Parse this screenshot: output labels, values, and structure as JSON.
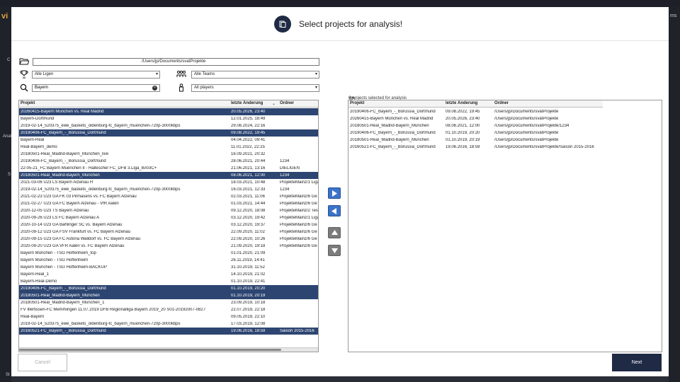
{
  "background": {
    "logo": "vi",
    "frag_right": "ms",
    "frag_left1": "C",
    "frag_left2": "Anal",
    "frag_left3": "S",
    "frag_left4": "St"
  },
  "dialog": {
    "title": "Select projects for analysis!"
  },
  "filters": {
    "path": "/Users/jp/Documents/svatProjekte",
    "league": "Alle Ligen",
    "team": "Alle Teams",
    "search": "Bayern",
    "player": "All players"
  },
  "left_table": {
    "columns": [
      "Projekt",
      "letzte Änderung",
      "Ordner"
    ],
    "sort_indicator": "⌄",
    "rows": [
      {
        "p": "20260415-Bayern München vs. Real Madrid",
        "d": "20.05.2026, 23:40",
        "o": "",
        "sel": true
      },
      {
        "p": "Bayern-Dortmund",
        "d": "12.01.2025, 18:49",
        "o": "",
        "sel": false
      },
      {
        "p": "2019-02-14_520375_ewe_baskets_oldenburg-fc_bayern_muenchen-720p-3000kbps",
        "d": "29.08.2024, 22:16",
        "o": "",
        "sel": false
      },
      {
        "p": "20190406-FC_Bayern_-_Borussia_Dortmund",
        "d": "09.08.2022, 19:45",
        "o": "",
        "sel": true
      },
      {
        "p": "Bayern-Real",
        "d": "04.04.2022, 09:41",
        "o": "",
        "sel": false
      },
      {
        "p": "Real-Bayern_demo",
        "d": "11.01.2022, 22:25",
        "o": "",
        "sel": false
      },
      {
        "p": "20180501-Real_Madrid-Bayern_München_live",
        "d": "16.09.2021, 20:32",
        "o": "",
        "sel": false
      },
      {
        "p": "20190406-FC_Bayern_-_Borussia_Dortmund",
        "d": "28.06.2021, 20:44",
        "o": "1234",
        "sel": false
      },
      {
        "p": "22-05-21_FC Bayern Muenchen II - Hallescher FC_DFB 3.Liga_BASIC+",
        "d": "21.06.2021, 13:16",
        "o": "DIELIGEN",
        "sel": false
      },
      {
        "p": "20180501-Real_Madrid-Bayern_München",
        "d": "08.06.2021, 12:00",
        "o": "1234",
        "sel": true
      },
      {
        "p": "2021-03-06 U23 LS Bayern Alzenau H",
        "d": "18.03.2021, 10:48",
        "o": "ProjekteMainz/1 Liga",
        "sel": false
      },
      {
        "p": "2019-02-14_520375_ewe_baskets_oldenburg-fc_bayern_muenchen-720p-3000kbps",
        "d": "16.03.2021, 12:33",
        "o": "1234",
        "sel": false
      },
      {
        "p": "2021-02-23 U23 GA FK 03 Pirmasens vs. FC Bayern Alzenau",
        "d": "02.03.2021, 11:06",
        "o": "ProjekteMainz/6 Ge",
        "sel": false
      },
      {
        "p": "2021-02-27 U23 GA FC Bayern Alzenau - VfR Aalen",
        "d": "01.03.2021, 14:44",
        "o": "ProjekteMainz/6 Ge",
        "sel": false
      },
      {
        "p": "2020-12-05 U23 TS Bayern Alzenau",
        "d": "09.12.2020, 18:08",
        "o": "ProjekteMainz/2 Tes",
        "sel": false
      },
      {
        "p": "2020-09-26 U23 LS FC Bayern Alzenau A",
        "d": "03.12.2020, 19:42",
        "o": "ProjekteMainz/1 Liga",
        "sel": false
      },
      {
        "p": "2020-10-14 U23 GA Bahlinger SC vs. Bayern Alzenau",
        "d": "03.12.2020, 19:37",
        "o": "ProjekteMainz/6 Ge",
        "sel": false
      },
      {
        "p": "2020-09-12 U23 GA FSV Frankfurt vs. FC Bayern Alzenau",
        "d": "22.09.2020, 11:02",
        "o": "ProjekteMainz/6 Ge",
        "sel": false
      },
      {
        "p": "2020-09-15 U23 GA FC Astoria Walldorf vs. FC Bayern Alzenau",
        "d": "22.09.2020, 10:26",
        "o": "ProjekteMainz/6 Ge",
        "sel": false
      },
      {
        "p": "2020-09-20 U23 GA VFR Aalen vs. FC Bayern Alzenau",
        "d": "21.09.2020, 19:18",
        "o": "ProjekteMainz/6 Ge",
        "sel": false
      },
      {
        "p": "Bayern München - TSG Hoffenheim_top",
        "d": "01.01.2020, 21:09",
        "o": "",
        "sel": false
      },
      {
        "p": "Bayern München - TSG Hoffenheim",
        "d": "26.11.2019, 14:41",
        "o": "",
        "sel": false
      },
      {
        "p": "Bayern München - TSG Hoffenheim-BACKUP",
        "d": "31.10.2019, 11:52",
        "o": "",
        "sel": false
      },
      {
        "p": "Bayern-Real_1",
        "d": "14.10.2019, 21:02",
        "o": "",
        "sel": false
      },
      {
        "p": "Bayern-Real-Demo",
        "d": "01.10.2019, 22:41",
        "o": "",
        "sel": false
      },
      {
        "p": "20190406-FC_Bayern_-_Borussia_Dortmund",
        "d": "01.10.2019, 20:20",
        "o": "",
        "sel": true
      },
      {
        "p": "20180501-Real_Madrid-Bayern_München",
        "d": "01.10.2019, 20:19",
        "o": "",
        "sel": true
      },
      {
        "p": "20180501-Real_Madrid-Bayern_München_1",
        "d": "23.09.2019, 10:18",
        "o": "",
        "sel": false
      },
      {
        "p": "FV Illertissen-FC Memmingen 11.07.2019 DFB Regionalliga Bayern 2019_20 S01-20192007-0827",
        "d": "22.07.2019, 22:18",
        "o": "",
        "sel": false
      },
      {
        "p": "Real-Bayern",
        "d": "09.05.2019, 22:10",
        "o": "",
        "sel": false
      },
      {
        "p": "2019-02-14_520375_ewe_baskets_oldenburg-fc_bayern_muenchen-720p-3000kbps",
        "d": "17.03.2019, 12:08",
        "o": "",
        "sel": false
      },
      {
        "p": "20160521-FC_Bayern_-_Borussia_Dortmund",
        "d": "19.06.2016, 18:59",
        "o": "Saison 2015-2016",
        "sel": true
      }
    ]
  },
  "right_panel": {
    "selected_count_text": "6 projects selected for analysis",
    "columns": [
      "Projekt",
      "letzte Änderung",
      "Ordner"
    ],
    "rows": [
      {
        "p": "20190406-FC_Bayern_-_Borussia_Dortmund",
        "d": "09.08.2022, 19:45",
        "o": "/Users/jp/Documents/svatProjekte"
      },
      {
        "p": "20260415-Bayern München vs. Real Madrid",
        "d": "20.05.2026, 23:40",
        "o": "/Users/jp/Documents/svatProjekte"
      },
      {
        "p": "20180501-Real_Madrid-Bayern_München",
        "d": "08.06.2021, 12:00",
        "o": "/Users/jp/Documents/svatProjekte/1234"
      },
      {
        "p": "20190406-FC_Bayern_-_Borussia_Dortmund",
        "d": "01.10.2019, 20:20",
        "o": "/Users/jp/Documents/svatProjekte"
      },
      {
        "p": "20180501-Real_Madrid-Bayern_München",
        "d": "01.10.2019, 20:19",
        "o": "/Users/jp/Documents/svatProjekte"
      },
      {
        "p": "20160521-FC_Bayern_-_Borussia_Dortmund",
        "d": "19.06.2016, 18:59",
        "o": "/Users/jp/Documents/svatProjekte/Saison 2015-2016"
      }
    ]
  },
  "buttons": {
    "cancel": "Cancel",
    "next": "Next"
  },
  "colors": {
    "selected_row": "#2d4571",
    "arrow_blue": "#3d73c9",
    "primary": "#1f2a44"
  }
}
